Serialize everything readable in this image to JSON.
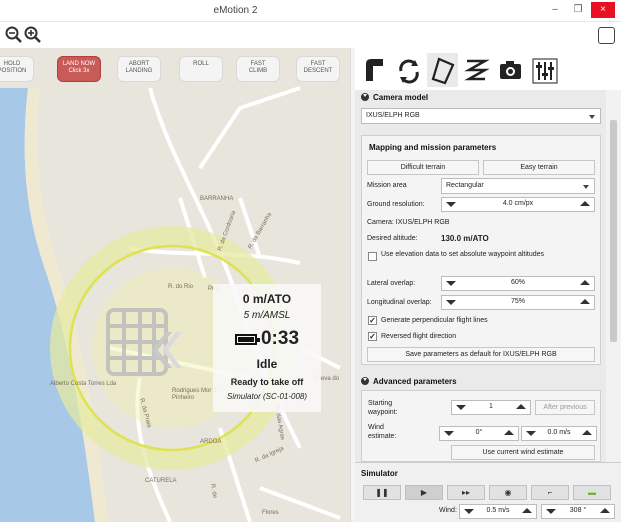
{
  "window": {
    "title": "eMotion 2",
    "min": "–",
    "max": "❐",
    "close": "×"
  },
  "commands": [
    {
      "label": "HOLD\nPOSITION",
      "danger": false
    },
    {
      "label": "LAND NOW\nClick 3x",
      "danger": true
    },
    {
      "label": "ABORT\nLANDING",
      "danger": false
    },
    {
      "label": "ROLL",
      "danger": false
    },
    {
      "label": "FAST\nCLIMB",
      "danger": false
    },
    {
      "label": "FAST\nDESCENT",
      "danger": false
    }
  ],
  "map": {
    "labels": [
      "BARRANHA",
      "R. do Rio",
      "PAU",
      "R. da Cordoaria",
      "R. da Barranha",
      "Alberto Costa Torres Lda",
      "Rodrigues Mor & Pinheiro",
      "R. da Praia",
      "ARDOA",
      "CATURELA",
      "R. das Agras",
      "Flores",
      "Fleva do",
      "R. da Igreja",
      "R. de"
    ],
    "status": {
      "altitude_ato": "0 m/ATO",
      "altitude_amsl": "5 m/AMSL",
      "flight_time": "0:33",
      "state": "Idle",
      "ready": "Ready to take off",
      "drone": "Simulator (SC-01-008)",
      "battery_level": 1.0
    }
  },
  "tabs": [
    "flight-plan-icon",
    "rotate-icon",
    "area-icon",
    "scan-path-icon",
    "camera-icon",
    "settings-sliders-icon"
  ],
  "camera": {
    "header": "Camera model",
    "selected": "IXUS/ELPH RGB"
  },
  "mapping": {
    "header": "Mapping and mission parameters",
    "difficult": "Difficult terrain",
    "easy": "Easy terrain",
    "mission_area_label": "Mission area",
    "mission_area_value": "Rectangular",
    "ground_res_label": "Ground resolution:",
    "ground_res_value": "4.0 cm/px",
    "camera_line": "Camera: IXUS/ELPH RGB",
    "desired_alt_label": "Desired altitude:",
    "desired_alt_value": "130.0 m/ATO",
    "elevation_label": "Use elevation data to set absolute waypoint altitudes",
    "elevation_checked": false,
    "lateral_label": "Lateral overlap:",
    "lateral_value": "60%",
    "longitudinal_label": "Longitudinal overlap:",
    "longitudinal_value": "75%",
    "perp_label": "Generate perpendicular flight lines",
    "perp_checked": true,
    "reverse_label": "Reversed flight direction",
    "reverse_checked": true,
    "save_label": "Save parameters as default for IXUS/ELPH RGB"
  },
  "advanced": {
    "header": "Advanced parameters",
    "start_label": "Starting waypoint:",
    "start_value": "1",
    "after_previous": "After previous",
    "wind_label": "Wind estimate:",
    "wind_dir": "0°",
    "wind_speed": "0.0 m/s",
    "use_wind": "Use current wind estimate"
  },
  "simulator": {
    "header": "Simulator",
    "buttons": [
      {
        "icon": "pause-icon",
        "glyph": "❚❚"
      },
      {
        "icon": "play-icon",
        "glyph": "▶"
      },
      {
        "icon": "fast-forward-icon",
        "glyph": "▸▸"
      },
      {
        "icon": "location-pin-icon",
        "glyph": "◉"
      },
      {
        "icon": "wind-sock-icon",
        "glyph": "⌐"
      },
      {
        "icon": "battery-icon",
        "glyph": "▬"
      }
    ],
    "wind_label": "Wind:",
    "wind_speed": "0.5 m/s",
    "wind_dir": "308 °"
  }
}
